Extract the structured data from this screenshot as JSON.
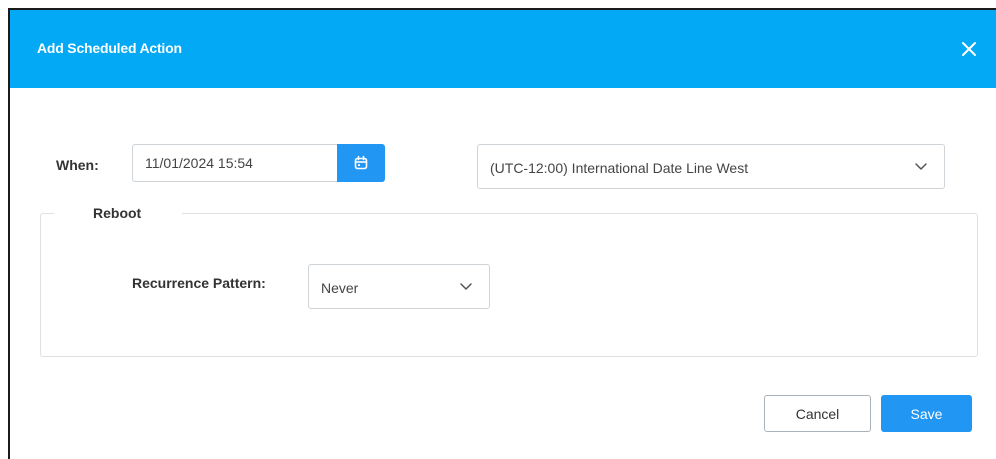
{
  "dialog": {
    "title": "Add Scheduled Action",
    "close_icon": "close-icon"
  },
  "when": {
    "label": "When:",
    "datetime_value": "11/01/2024 15:54",
    "calendar_icon": "calendar-icon"
  },
  "timezone": {
    "selected": "(UTC-12:00) International Date Line West",
    "chevron_icon": "chevron-down-icon"
  },
  "action_group": {
    "legend": "Reboot",
    "recurrence_label": "Recurrence Pattern:",
    "recurrence_selected": "Never",
    "chevron_icon": "chevron-down-icon"
  },
  "footer": {
    "cancel_label": "Cancel",
    "save_label": "Save"
  },
  "colors": {
    "header_bg": "#03a9f4",
    "primary": "#2196f3",
    "border": "#cfd4d8"
  }
}
